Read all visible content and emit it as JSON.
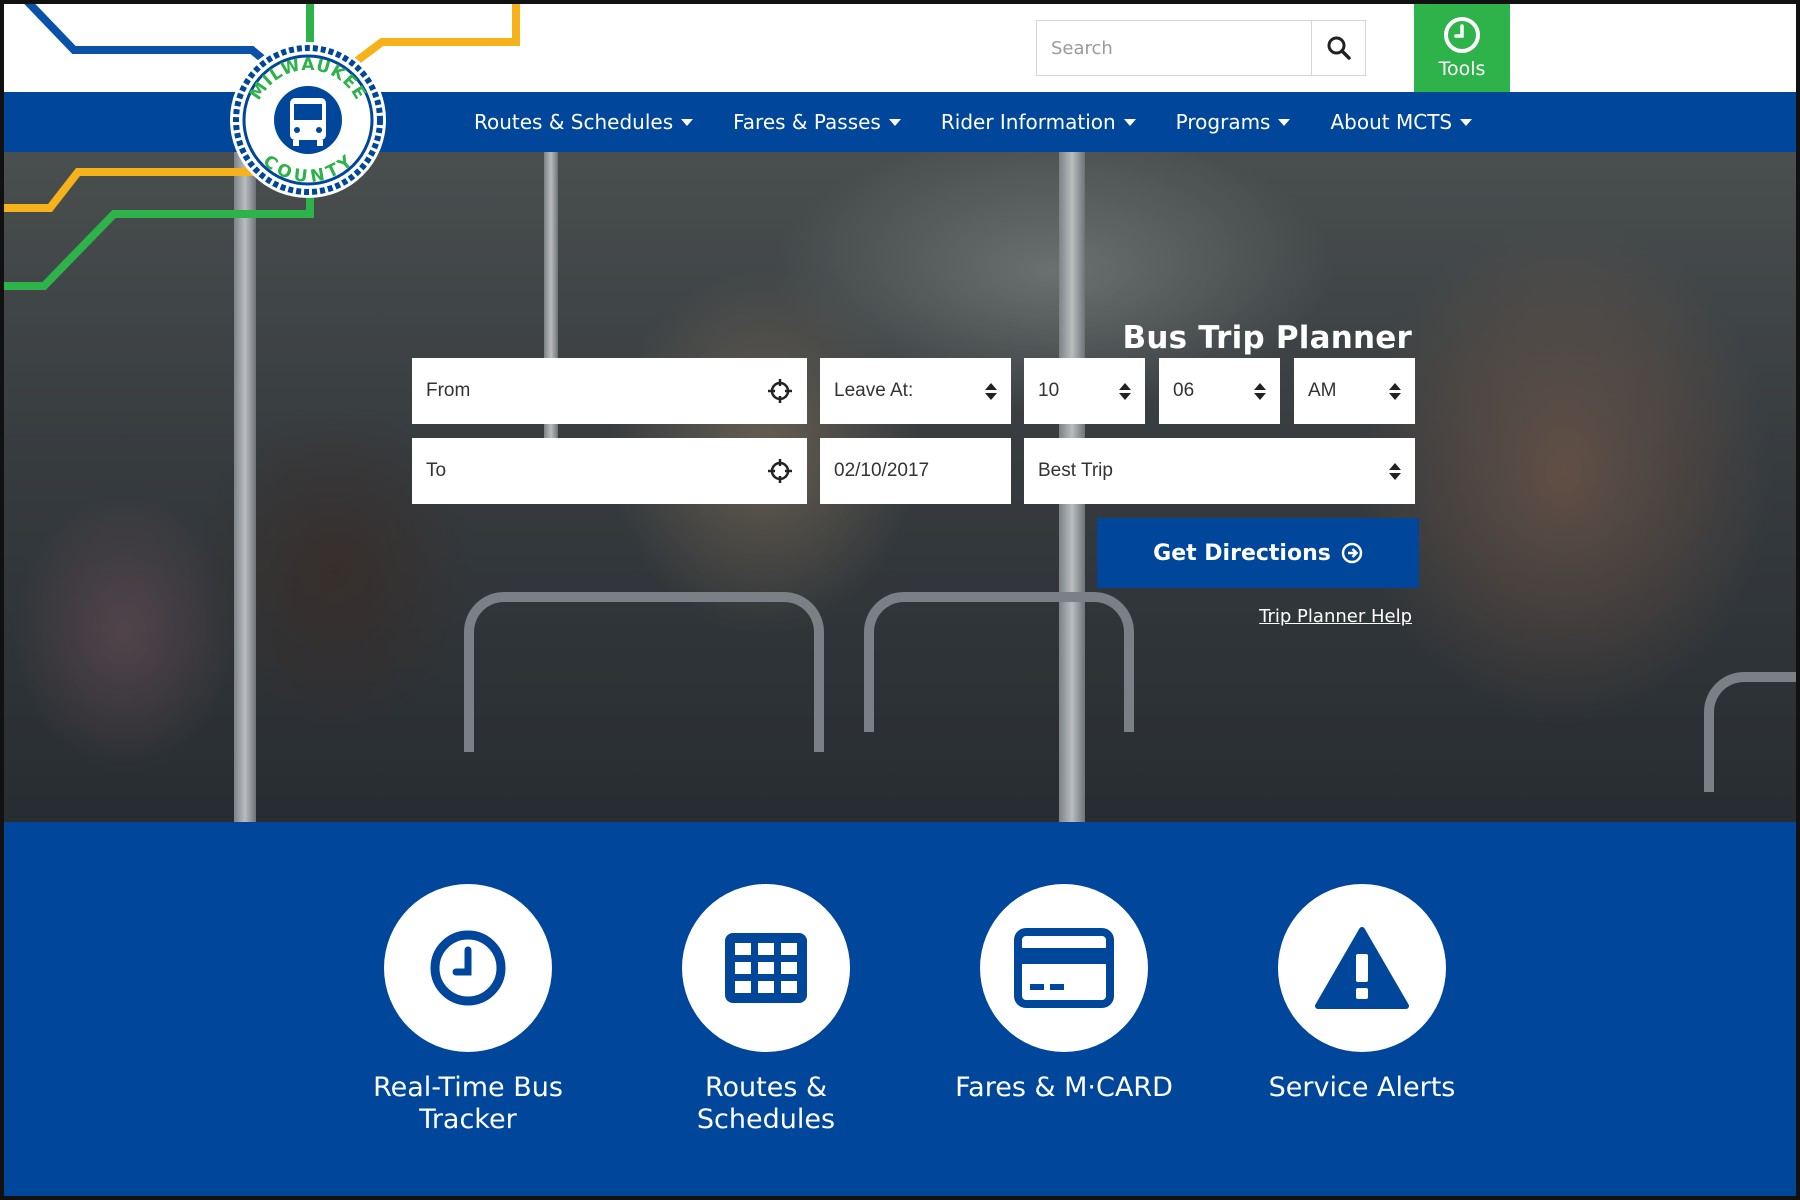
{
  "header": {
    "search": {
      "placeholder": "Search",
      "value": ""
    },
    "search_icon": "search-icon",
    "tools": {
      "label": "Tools",
      "icon": "clock-icon"
    },
    "logo": {
      "top_text": "MILWAUKEE",
      "bottom_text": "COUNTY",
      "icon": "bus-icon"
    }
  },
  "nav": {
    "items": [
      {
        "label": "Routes & Schedules"
      },
      {
        "label": "Fares & Passes"
      },
      {
        "label": "Rider Information"
      },
      {
        "label": "Programs"
      },
      {
        "label": "About MCTS"
      }
    ]
  },
  "planner": {
    "title": "Bus Trip Planner",
    "from": {
      "placeholder": "From",
      "icon": "crosshair-icon"
    },
    "to": {
      "placeholder": "To",
      "icon": "crosshair-icon"
    },
    "leave_at": "Leave At:",
    "hour": "10",
    "minute": "06",
    "ampm": "AM",
    "date": "02/10/2017",
    "trip_type": "Best Trip",
    "button": {
      "label": "Get Directions",
      "icon": "arrow-circle-right-icon"
    },
    "help": "Trip Planner Help"
  },
  "quick_links": [
    {
      "label_line1": "Real-Time Bus",
      "label_line2": "Tracker",
      "icon": "clock-icon"
    },
    {
      "label_line1": "Routes &",
      "label_line2": "Schedules",
      "icon": "grid-icon"
    },
    {
      "label_line1": "Fares & M·CARD",
      "label_line2": "",
      "icon": "card-icon"
    },
    {
      "label_line1": "Service Alerts",
      "label_line2": "",
      "icon": "alert-triangle-icon"
    }
  ],
  "colors": {
    "brand_blue": "#00469b",
    "tools_green": "#2eb24a",
    "line_yellow": "#f6b21b",
    "line_green": "#2eb24a"
  }
}
